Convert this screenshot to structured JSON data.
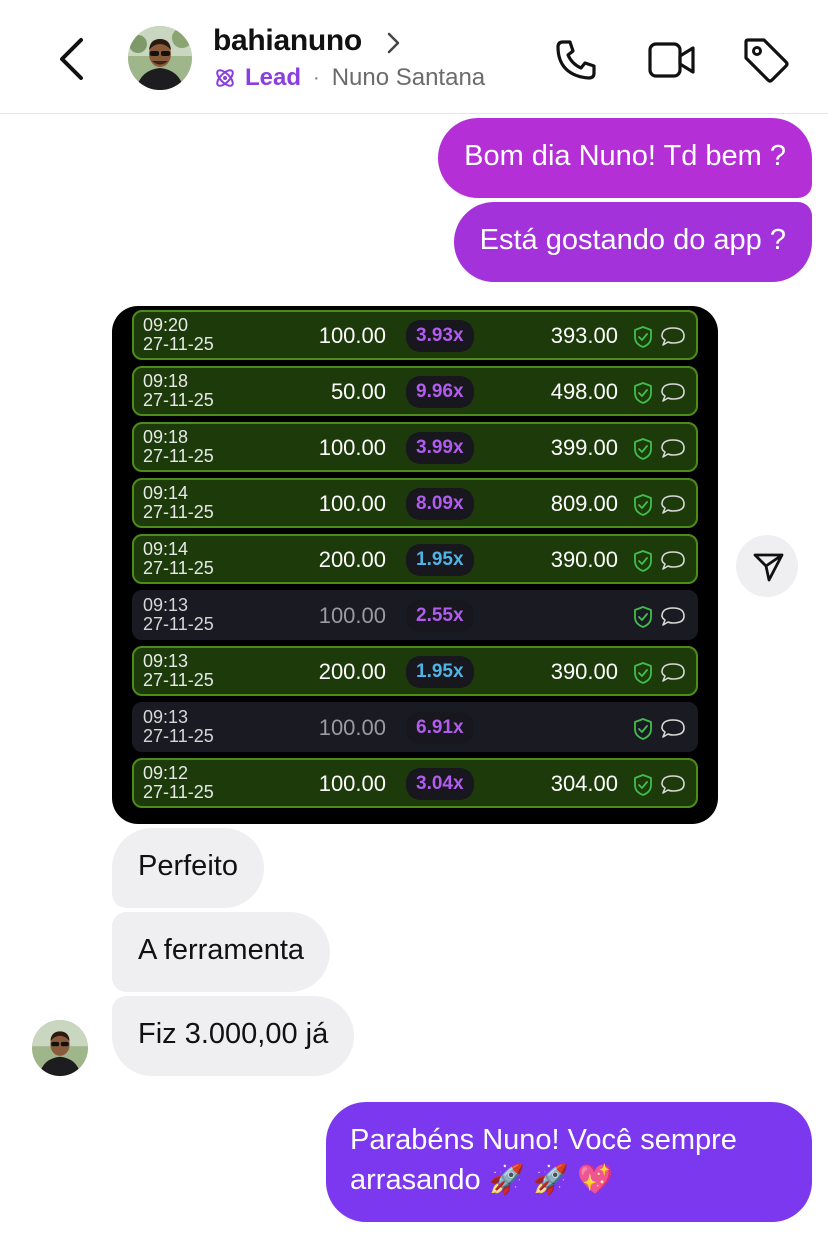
{
  "header": {
    "username": "bahianuno",
    "lead_label": "Lead",
    "separator": "·",
    "full_name": "Nuno Santana"
  },
  "colors": {
    "lead_purple": "#8b3ee0",
    "bubble_magenta": "#b52fd6",
    "bubble_violet": "#7b38ee",
    "win_green": "#4e8c1a"
  },
  "icons": {
    "back": "chevron-left-icon",
    "call": "phone-icon",
    "video": "video-camera-icon",
    "tag": "tag-icon",
    "share": "send-icon"
  },
  "messages": {
    "out1": "Bom dia Nuno! Td bem ?",
    "out2": "Está gostando do app ?",
    "in1": "Perfeito",
    "in2": "A ferramenta",
    "in3": "Fiz 3.000,00 já",
    "out3_line1": "Parabéns Nuno! Você sempre",
    "out3_line2": "arrasando 🚀 🚀 💖"
  },
  "bets": [
    {
      "time": "09:20",
      "date": "27-11-25",
      "bet": "100.00",
      "mult": "3.93x",
      "payout": "393.00",
      "status": "win",
      "mult_color": "#b15bf0"
    },
    {
      "time": "09:18",
      "date": "27-11-25",
      "bet": "50.00",
      "mult": "9.96x",
      "payout": "498.00",
      "status": "win",
      "mult_color": "#b15bf0"
    },
    {
      "time": "09:18",
      "date": "27-11-25",
      "bet": "100.00",
      "mult": "3.99x",
      "payout": "399.00",
      "status": "win",
      "mult_color": "#b15bf0"
    },
    {
      "time": "09:14",
      "date": "27-11-25",
      "bet": "100.00",
      "mult": "8.09x",
      "payout": "809.00",
      "status": "win",
      "mult_color": "#b15bf0"
    },
    {
      "time": "09:14",
      "date": "27-11-25",
      "bet": "200.00",
      "mult": "1.95x",
      "payout": "390.00",
      "status": "win",
      "mult_color": "#4fb3e8"
    },
    {
      "time": "09:13",
      "date": "27-11-25",
      "bet": "100.00",
      "mult": "2.55x",
      "payout": "",
      "status": "lose",
      "mult_color": "#b15bf0"
    },
    {
      "time": "09:13",
      "date": "27-11-25",
      "bet": "200.00",
      "mult": "1.95x",
      "payout": "390.00",
      "status": "win",
      "mult_color": "#4fb3e8"
    },
    {
      "time": "09:13",
      "date": "27-11-25",
      "bet": "100.00",
      "mult": "6.91x",
      "payout": "",
      "status": "lose",
      "mult_color": "#b15bf0"
    },
    {
      "time": "09:12",
      "date": "27-11-25",
      "bet": "100.00",
      "mult": "3.04x",
      "payout": "304.00",
      "status": "win",
      "mult_color": "#b15bf0"
    }
  ]
}
